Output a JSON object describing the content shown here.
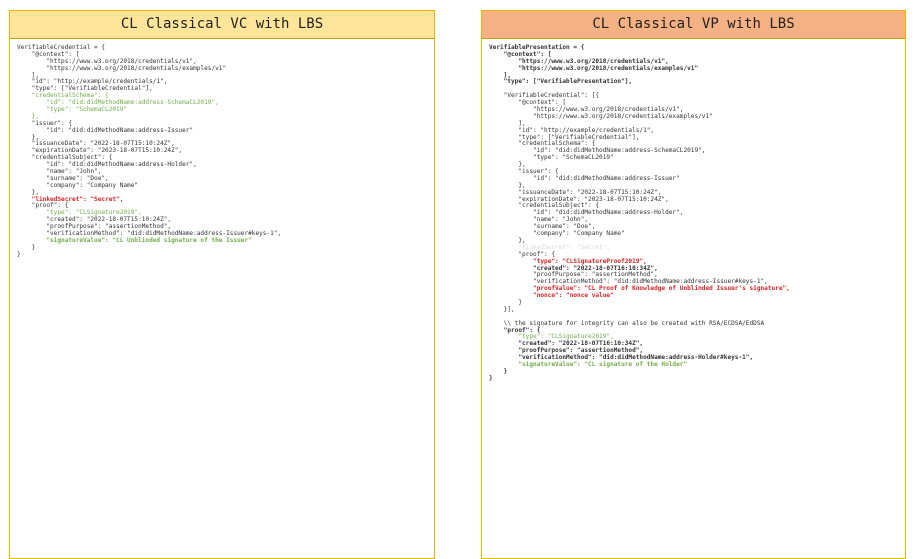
{
  "left_panel": {
    "title": "CL Classical VC with LBS",
    "lines": [
      {
        "t": "VerifiableCredential = {",
        "s": ""
      },
      {
        "t": "    \"@context\": [",
        "s": ""
      },
      {
        "t": "        \"https://www.w3.org/2018/credentials/v1\",",
        "s": ""
      },
      {
        "t": "        \"https://www.w3.org/2018/credentials/examples/v1\"",
        "s": ""
      },
      {
        "t": "    ],",
        "s": ""
      },
      {
        "t": "    \"id\": \"http://example/credentials/1\",",
        "s": ""
      },
      {
        "t": "    \"type\": [\"VerifiableCredential\"],",
        "s": ""
      },
      {
        "t": "    \"credentialSchema\": {",
        "s": "g"
      },
      {
        "t": "        \"id\": \"did:didMethodName:address-SchemaCL2019\",",
        "s": "g"
      },
      {
        "t": "        \"type\": \"SchemaCL2019\"",
        "s": "g"
      },
      {
        "t": "    },",
        "s": "g"
      },
      {
        "t": "    \"issuer\": {",
        "s": ""
      },
      {
        "t": "        \"id\": \"did:didMethodName:address-Issuer\"",
        "s": ""
      },
      {
        "t": "    },",
        "s": ""
      },
      {
        "t": "    \"issuanceDate\": \"2022-18-07T15:10:24Z\",",
        "s": ""
      },
      {
        "t": "    \"expirationDate\": \"2023-18-07T15:10:24Z\",",
        "s": ""
      },
      {
        "t": "    \"credentialSubject\": {",
        "s": ""
      },
      {
        "t": "        \"id\": \"did:didMethodName:address-Holder\",",
        "s": ""
      },
      {
        "t": "        \"name\": \"John\",",
        "s": ""
      },
      {
        "t": "        \"surname\": \"Doe\",",
        "s": ""
      },
      {
        "t": "        \"company\": \"Company Name\"",
        "s": ""
      },
      {
        "t": "    },",
        "s": ""
      },
      {
        "t": "    \"linkedSecret\": \"Secret\",",
        "s": "r b"
      },
      {
        "t": "    \"proof\": {",
        "s": ""
      },
      {
        "t": "        \"type\": \"CLSignature2019\",",
        "s": "g"
      },
      {
        "t": "        \"created\": \"2022-18-07T15:10:24Z\",",
        "s": ""
      },
      {
        "t": "        \"proofPurpose\": \"assertionMethod\",",
        "s": ""
      },
      {
        "t": "        \"verificationMethod\": \"did:didMethodName:address-Issuer#keys-1\",",
        "s": ""
      },
      {
        "t": "        \"signatureValue\": \"CL Unblinded signature of the Issuer\"",
        "s": "g b"
      },
      {
        "t": "    }",
        "s": ""
      },
      {
        "t": "}",
        "s": ""
      }
    ]
  },
  "right_panel": {
    "title": "CL Classical VP with LBS",
    "lines": [
      {
        "t": "VerifiablePresentation = {",
        "s": "b"
      },
      {
        "t": "    \"@context\": [",
        "s": "b"
      },
      {
        "t": "        \"https://www.w3.org/2018/credentials/v1\",",
        "s": "b"
      },
      {
        "t": "        \"https://www.w3.org/2018/credentials/examples/v1\"",
        "s": "b"
      },
      {
        "t": "    ],",
        "s": "b"
      },
      {
        "t": "    \"type\": [\"VerifiablePresentation\"],",
        "s": "b"
      },
      {
        "t": "",
        "s": ""
      },
      {
        "t": "    \"VerifiableCredential\": [{",
        "s": ""
      },
      {
        "t": "        \"@context\": [",
        "s": ""
      },
      {
        "t": "            \"https://www.w3.org/2018/credentials/v1\",",
        "s": ""
      },
      {
        "t": "            \"https://www.w3.org/2018/credentials/examples/v1\"",
        "s": ""
      },
      {
        "t": "        ],",
        "s": ""
      },
      {
        "t": "        \"id\": \"http://example/credentials/1\",",
        "s": ""
      },
      {
        "t": "        \"type\": [\"VerifiableCredential\"],",
        "s": ""
      },
      {
        "t": "        \"credentialSchema\": {",
        "s": ""
      },
      {
        "t": "            \"id\": \"did:didMethodName:address-SchemaCL2019\",",
        "s": ""
      },
      {
        "t": "            \"type\": \"SchemaCL2019\"",
        "s": ""
      },
      {
        "t": "        },",
        "s": ""
      },
      {
        "t": "        \"issuer\": {",
        "s": ""
      },
      {
        "t": "            \"id\": \"did:didMethodName:address-Issuer\"",
        "s": ""
      },
      {
        "t": "        },",
        "s": ""
      },
      {
        "t": "        \"issuanceDate\": \"2022-18-07T15:10:24Z\",",
        "s": ""
      },
      {
        "t": "        \"expirationDate\": \"2023-18-07T15:10:24Z\",",
        "s": ""
      },
      {
        "t": "        \"credentialSubject\": {",
        "s": ""
      },
      {
        "t": "            \"id\": \"did:didMethodName:address-Holder\",",
        "s": ""
      },
      {
        "t": "            \"name\": \"John\",",
        "s": ""
      },
      {
        "t": "            \"surname\": \"Doe\",",
        "s": ""
      },
      {
        "t": "            \"company\": \"Company Name\"",
        "s": ""
      },
      {
        "t": "        },",
        "s": ""
      },
      {
        "t": "        \"linkedSecret\": \"Secret\",",
        "s": "gr"
      },
      {
        "t": "        \"proof\": {",
        "s": ""
      },
      {
        "t": "            \"type\": \"CLSignatureProof2019\",",
        "s": "r b"
      },
      {
        "t": "            \"created\": \"2022-18-07T16:10:34Z\",",
        "s": "b"
      },
      {
        "t": "            \"proofPurpose\": \"assertionMethod\",",
        "s": ""
      },
      {
        "t": "            \"verificationMethod\": \"did:didMethodName:address-Issuer#keys-1\",",
        "s": ""
      },
      {
        "t": "            \"proofValue\": \"CL Proof of Knowledge of Unblinded Issuer's signature\",",
        "s": "r b"
      },
      {
        "t": "            \"nonce\": \"nonce value\"",
        "s": "r b"
      },
      {
        "t": "        }",
        "s": ""
      },
      {
        "t": "    }],",
        "s": ""
      },
      {
        "t": "",
        "s": ""
      },
      {
        "t": "    \\\\ the signature for integrity can also be created with RSA/ECDSA/EdDSA",
        "s": ""
      },
      {
        "t": "    \"proof\": {",
        "s": "b"
      },
      {
        "t": "        \"type\": \"CLSignature2019\",",
        "s": "g"
      },
      {
        "t": "        \"created\": \"2022-18-07T16:10:34Z\",",
        "s": "b"
      },
      {
        "t": "        \"proofPurpose\": \"assertionMethod\",",
        "s": "b"
      },
      {
        "t": "        \"verificationMethod\": \"did:didMethodName:address-Holder#keys-1\",",
        "s": "b"
      },
      {
        "t": "        \"signatureValue\": \"CL signature of the Holder\"",
        "s": "g b"
      },
      {
        "t": "    }",
        "s": "b"
      },
      {
        "t": "}",
        "s": "b"
      }
    ]
  },
  "colors": {
    "left_title_bg": "#ffe599",
    "right_title_bg": "#f4b183",
    "border": "#f0b400",
    "highlight_green": "#70ad47",
    "highlight_red": "#e02020"
  }
}
